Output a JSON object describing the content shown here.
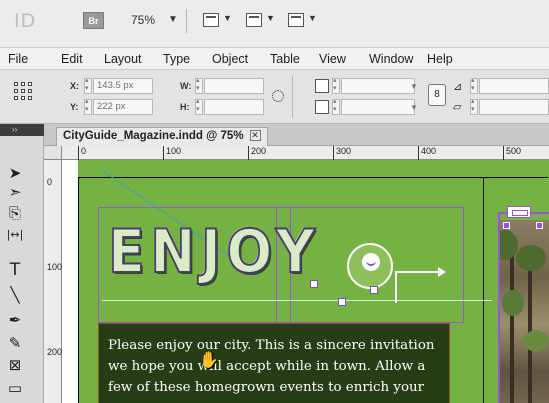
{
  "appbar": {
    "logo": "ID",
    "bridge_badge": "Br",
    "zoom": "75%",
    "view_icons": [
      "screen-mode-icon",
      "view-options-icon",
      "arrange-documents-icon"
    ]
  },
  "menubar": {
    "items": [
      "File",
      "Edit",
      "Layout",
      "Type",
      "Object",
      "Table",
      "View",
      "Window",
      "Help"
    ]
  },
  "control": {
    "x_label": "X:",
    "y_label": "Y:",
    "w_label": "W:",
    "h_label": "H:",
    "x_value": "143.5 px",
    "y_value": "222 px",
    "w_value": "",
    "h_value": ""
  },
  "tools": {
    "items": [
      {
        "name": "selection-tool",
        "glyph": "➤"
      },
      {
        "name": "direct-selection-tool",
        "glyph": "➣"
      },
      {
        "name": "page-tool",
        "glyph": "⎘"
      },
      {
        "name": "gap-tool",
        "glyph": "|↔|"
      },
      {
        "name": "type-tool",
        "glyph": "T"
      },
      {
        "name": "line-tool",
        "glyph": "╲"
      },
      {
        "name": "pen-tool",
        "glyph": "✒"
      },
      {
        "name": "pencil-tool",
        "glyph": "✎"
      },
      {
        "name": "rectangle-frame-tool",
        "glyph": "⊠"
      },
      {
        "name": "rectangle-tool",
        "glyph": "▭"
      }
    ]
  },
  "document": {
    "tab_title": "CityGuide_Magazine.indd @ 75%",
    "close_glyph": "✕"
  },
  "ruler": {
    "h_labels": [
      "0",
      "100",
      "200",
      "300",
      "400",
      "500"
    ],
    "v_labels": [
      "0",
      "100",
      "200"
    ]
  },
  "canvas": {
    "headline": "ENJOY",
    "body_lines": [
      "Please enjoy our city. This is a sincere invitation",
      "we hope you will accept while in town. Allow a",
      "few of these homegrown events to enrich your"
    ]
  },
  "colors": {
    "page_green": "#76b243",
    "text_box_dark": "#263d16",
    "selection_purple": "#9a55d6"
  }
}
